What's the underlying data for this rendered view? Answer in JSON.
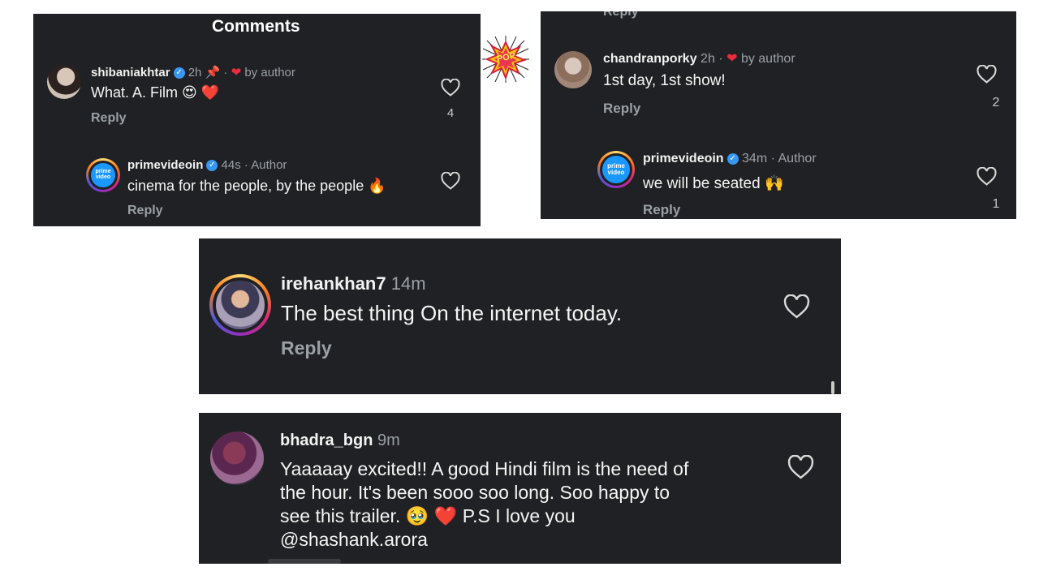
{
  "panel1": {
    "title": "Comments",
    "comment": {
      "username": "shibaniakhtar",
      "time": "2h",
      "pin_icon": "pin-icon",
      "dot": "·",
      "by_author": "by author",
      "text": "What. A. Film 😍 ❤️",
      "reply": "Reply",
      "likes": "4"
    },
    "reply_comment": {
      "username": "primevideoin",
      "time": "44s",
      "author_tag": "· Author",
      "text": "cinema for the people, by the people 🔥",
      "reply": "Reply",
      "logo_text": "prime video"
    }
  },
  "panel2": {
    "top_cutoff": "Reply",
    "comment": {
      "username": "chandranporky",
      "time": "2h",
      "dot": "·",
      "by_author": "by author",
      "text": "1st day, 1st show!",
      "reply": "Reply",
      "likes": "2"
    },
    "reply_comment": {
      "username": "primevideoin",
      "time": "34m",
      "author_tag": "· Author",
      "text": "we will be seated 🙌",
      "reply": "Reply",
      "likes": "1",
      "logo_text": "prime video"
    }
  },
  "panel3": {
    "comment": {
      "username": "irehankhan7",
      "time": "14m",
      "text": "The best thing On the internet today.",
      "reply": "Reply"
    }
  },
  "panel4": {
    "comment": {
      "username": "bhadra_bgn",
      "time": "9m",
      "lines": [
        "Yaaaaay excited!! A good Hindi film is the need of",
        "the hour. It's been sooo soo long. Soo happy to",
        "see this trailer. 🥹 ❤️ P.S I love you",
        "@shashank.arora"
      ]
    }
  },
  "sticker": {
    "text": "POP"
  },
  "colors": {
    "panel_bg": "#202124",
    "meta": "#9aa0a6",
    "verified": "#3897f0",
    "heart_red": "#ed2b3d"
  }
}
